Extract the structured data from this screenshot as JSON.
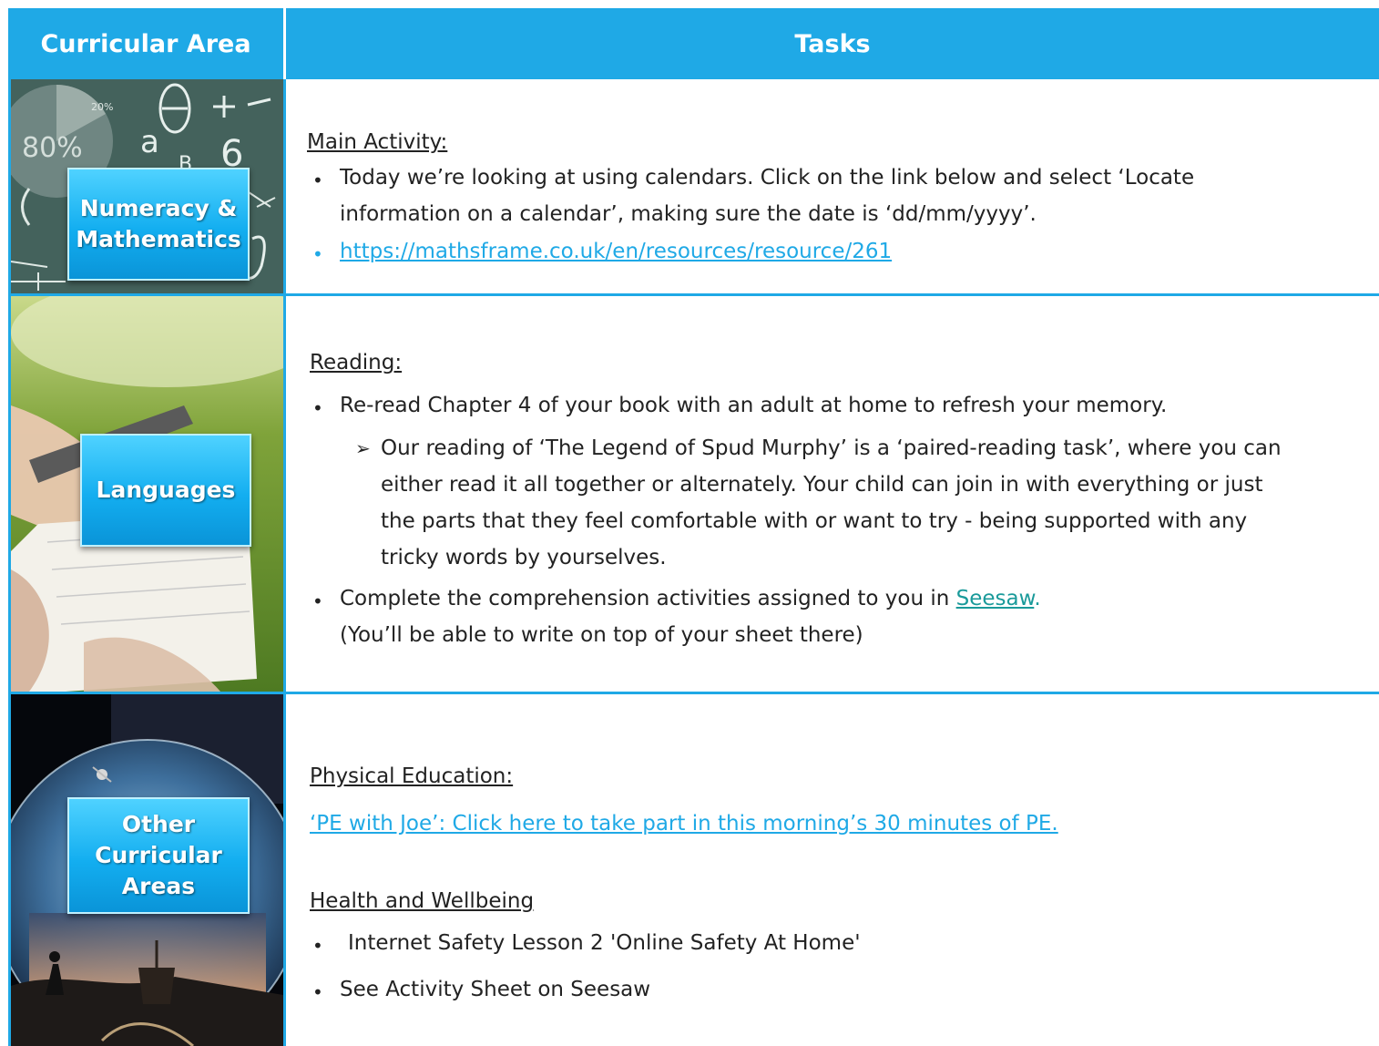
{
  "header": {
    "curricular_area": "Curricular Area",
    "tasks": "Tasks"
  },
  "rows": [
    {
      "label_line1": "Numeracy &",
      "label_line2": "Mathematics",
      "heading": "Main Activity:",
      "item1_line1": "Today we’re looking at using calendars. Click on the link below and select ‘Locate",
      "item1_line2": "information on a calendar’, making sure the date is ‘dd/mm/yyyy’.",
      "link": "https://mathsframe.co.uk/en/resources/resource/261"
    },
    {
      "label": "Languages",
      "heading": "Reading:",
      "item1": "Re-read Chapter 4 of your book with an adult at home to refresh your memory.",
      "sub_line1": "Our reading of ‘The Legend of Spud Murphy’ is a ‘paired-reading task’, where you can",
      "sub_line2": "either read it all together or alternately. Your child can join in with everything or just",
      "sub_line3": "the parts that they feel comfortable with or want to try - being supported with any",
      "sub_line4": "tricky words by yourselves.",
      "item2_prefix": "Complete the comprehension activities assigned to you in ",
      "item2_link": "Seesaw",
      "item2_suffix": ".",
      "item2_line2": "(You’ll be able to write on top of your sheet there)"
    },
    {
      "label_line1": "Other",
      "label_line2": "Curricular",
      "label_line3": "Areas",
      "heading1": "Physical Education:",
      "pe_link": "‘PE with Joe’: Click here to take part in this morning’s 30 minutes of PE.",
      "heading2": "Health and Wellbeing",
      "item1": "Internet Safety Lesson 2 'Online Safety At Home'",
      "item2": "See Activity Sheet on Seesaw"
    }
  ],
  "colors": {
    "accent": "#1fa9e6",
    "label_box": "#13aef0",
    "text": "#222222"
  }
}
